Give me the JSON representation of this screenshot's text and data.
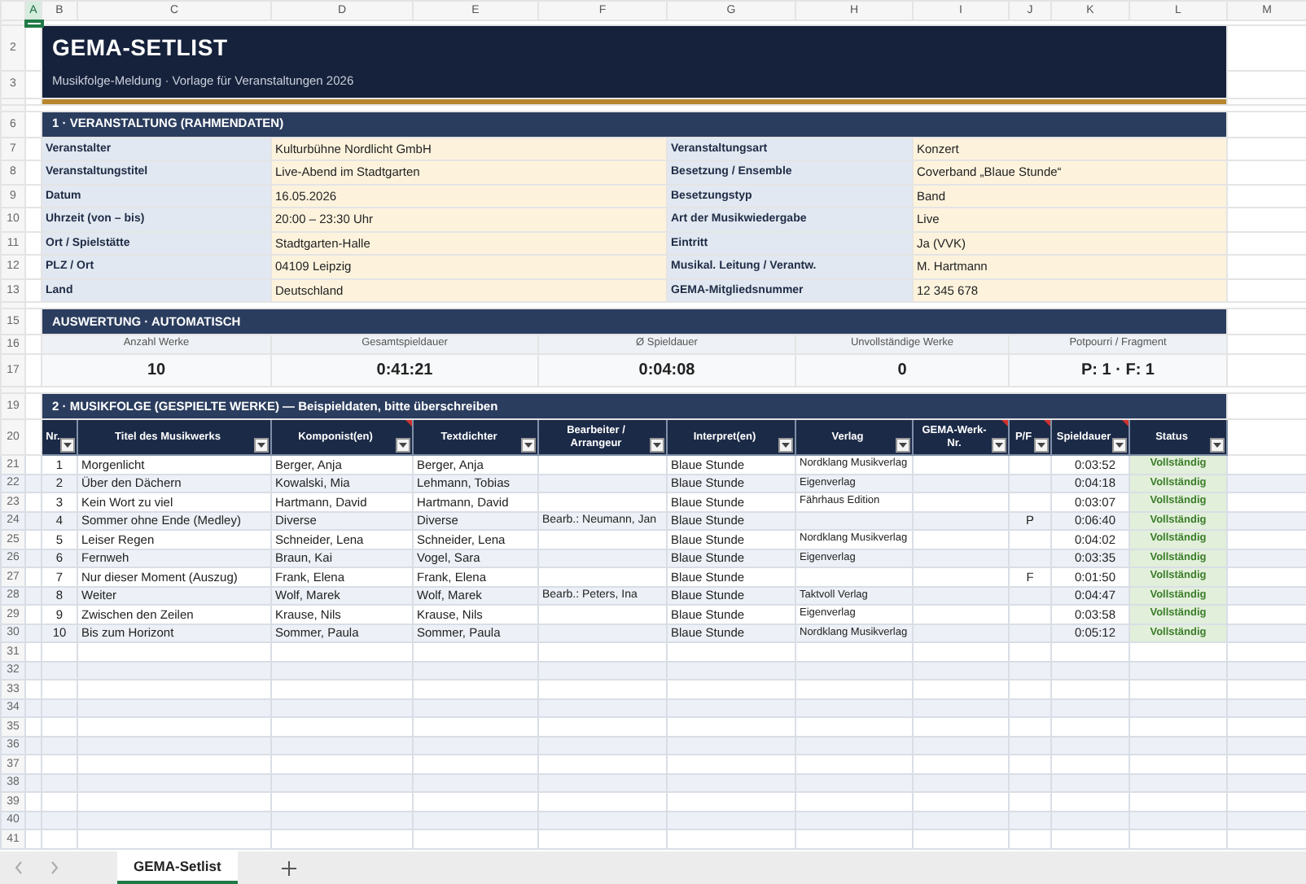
{
  "columns": [
    {
      "label": "A",
      "selected": true
    },
    {
      "label": "B",
      "selected": false
    },
    {
      "label": "C",
      "selected": false
    },
    {
      "label": "D",
      "selected": false
    },
    {
      "label": "E",
      "selected": false
    },
    {
      "label": "F",
      "selected": false
    },
    {
      "label": "G",
      "selected": false
    },
    {
      "label": "H",
      "selected": false
    },
    {
      "label": "I",
      "selected": false
    },
    {
      "label": "J",
      "selected": false
    },
    {
      "label": "K",
      "selected": false
    },
    {
      "label": "L",
      "selected": false
    },
    {
      "label": "M",
      "selected": false
    }
  ],
  "row_numbers": [
    "2",
    "3",
    "6",
    "7",
    "8",
    "9",
    "10",
    "11",
    "12",
    "13",
    "15",
    "16",
    "17",
    "19",
    "20",
    "21",
    "22",
    "23",
    "24",
    "25",
    "26",
    "27",
    "28",
    "29",
    "30",
    "31",
    "32",
    "33",
    "34",
    "35",
    "36",
    "37",
    "38",
    "39",
    "40",
    "41"
  ],
  "title": "GEMA-SETLIST",
  "subtitle": "Musikfolge-Meldung  ·  Vorlage für Veranstaltungen 2026",
  "event": {
    "heading": "1  ·  VERANSTALTUNG  (RAHMENDATEN)",
    "rows": [
      [
        {
          "label": "Veranstalter",
          "value": "Kulturbühne Nordlicht GmbH"
        },
        {
          "label": "Veranstaltungsart",
          "value": "Konzert"
        }
      ],
      [
        {
          "label": "Veranstaltungstitel",
          "value": "Live-Abend im Stadtgarten"
        },
        {
          "label": "Besetzung / Ensemble",
          "value": "Coverband „Blaue Stunde“"
        }
      ],
      [
        {
          "label": "Datum",
          "value": "16.05.2026"
        },
        {
          "label": "Besetzungstyp",
          "value": "Band"
        }
      ],
      [
        {
          "label": "Uhrzeit (von – bis)",
          "value": "20:00 – 23:30 Uhr"
        },
        {
          "label": "Art der Musikwiedergabe",
          "value": "Live"
        }
      ],
      [
        {
          "label": "Ort / Spielstätte",
          "value": "Stadtgarten-Halle"
        },
        {
          "label": "Eintritt",
          "value": "Ja (VVK)"
        }
      ],
      [
        {
          "label": "PLZ / Ort",
          "value": "04109 Leipzig"
        },
        {
          "label": "Musikal. Leitung / Verantw.",
          "value": "M. Hartmann"
        }
      ],
      [
        {
          "label": "Land",
          "value": "Deutschland"
        },
        {
          "label": "GEMA-Mitgliedsnummer",
          "value": "12 345 678"
        }
      ]
    ]
  },
  "summary": {
    "heading": "AUSWERTUNG  ·  AUTOMATISCH",
    "stats": [
      {
        "label": "Anzahl Werke",
        "value": "10"
      },
      {
        "label": "Gesamtspieldauer",
        "value": "0:41:21"
      },
      {
        "label": "Ø Spieldauer",
        "value": "0:04:08"
      },
      {
        "label": "Unvollständige Werke",
        "value": "0"
      },
      {
        "label": "Potpourri / Fragment",
        "value": "P: 1   ·   F: 1"
      }
    ]
  },
  "setlist": {
    "heading": "2  ·  MUSIKFOLGE  (GESPIELTE WERKE)   —   Beispieldaten, bitte überschreiben",
    "columns": [
      {
        "label": "Nr.",
        "comment": false
      },
      {
        "label": "Titel des Musikwerks",
        "comment": false
      },
      {
        "label": "Komponist(en)",
        "comment": true
      },
      {
        "label": "Textdichter",
        "comment": false
      },
      {
        "label": "Bearbeiter / Arrangeur",
        "comment": false
      },
      {
        "label": "Interpret(en)",
        "comment": false
      },
      {
        "label": "Verlag",
        "comment": false
      },
      {
        "label": "GEMA-Werk-Nr.",
        "comment": true
      },
      {
        "label": "P/F",
        "comment": true
      },
      {
        "label": "Spieldauer",
        "comment": true
      },
      {
        "label": "Status",
        "comment": false
      }
    ],
    "rows": [
      {
        "nr": "1",
        "title": "Morgenlicht",
        "composer": "Berger, Anja",
        "lyricist": "Berger, Anja",
        "performer": "Blaue Stunde",
        "publisher": "Nordklang Musikverlag",
        "duration": "0:03:52",
        "status": "Vollständig"
      },
      {
        "nr": "2",
        "title": "Über den Dächern",
        "composer": "Kowalski, Mia",
        "lyricist": "Lehmann, Tobias",
        "performer": "Blaue Stunde",
        "publisher": "Eigenverlag",
        "duration": "0:04:18",
        "status": "Vollständig"
      },
      {
        "nr": "3",
        "title": "Kein Wort zu viel",
        "composer": "Hartmann, David",
        "lyricist": "Hartmann, David",
        "performer": "Blaue Stunde",
        "publisher": "Fährhaus Edition",
        "duration": "0:03:07",
        "status": "Vollständig"
      },
      {
        "nr": "4",
        "title": "Sommer ohne Ende (Medley)",
        "composer": "Diverse",
        "lyricist": "Diverse",
        "arranger": "Bearb.: Neumann, Jan",
        "performer": "Blaue Stunde",
        "pf": "P",
        "duration": "0:06:40",
        "status": "Vollständig"
      },
      {
        "nr": "5",
        "title": "Leiser Regen",
        "composer": "Schneider, Lena",
        "lyricist": "Schneider, Lena",
        "performer": "Blaue Stunde",
        "publisher": "Nordklang Musikverlag",
        "duration": "0:04:02",
        "status": "Vollständig"
      },
      {
        "nr": "6",
        "title": "Fernweh",
        "composer": "Braun, Kai",
        "lyricist": "Vogel, Sara",
        "performer": "Blaue Stunde",
        "publisher": "Eigenverlag",
        "duration": "0:03:35",
        "status": "Vollständig"
      },
      {
        "nr": "7",
        "title": "Nur dieser Moment (Auszug)",
        "composer": "Frank, Elena",
        "lyricist": "Frank, Elena",
        "performer": "Blaue Stunde",
        "pf": "F",
        "duration": "0:01:50",
        "status": "Vollständig"
      },
      {
        "nr": "8",
        "title": "Weiter",
        "composer": "Wolf, Marek",
        "lyricist": "Wolf, Marek",
        "arranger": "Bearb.: Peters, Ina",
        "performer": "Blaue Stunde",
        "publisher": "Taktvoll Verlag",
        "duration": "0:04:47",
        "status": "Vollständig"
      },
      {
        "nr": "9",
        "title": "Zwischen den Zeilen",
        "composer": "Krause, Nils",
        "lyricist": "Krause, Nils",
        "performer": "Blaue Stunde",
        "publisher": "Eigenverlag",
        "duration": "0:03:58",
        "status": "Vollständig"
      },
      {
        "nr": "10",
        "title": "Bis zum Horizont",
        "composer": "Sommer, Paula",
        "lyricist": "Sommer, Paula",
        "performer": "Blaue Stunde",
        "publisher": "Nordklang Musikverlag",
        "duration": "0:05:12",
        "status": "Vollständig"
      }
    ]
  },
  "sheet_tabs": [
    {
      "label": "GEMA-Setlist",
      "selected": true
    }
  ]
}
